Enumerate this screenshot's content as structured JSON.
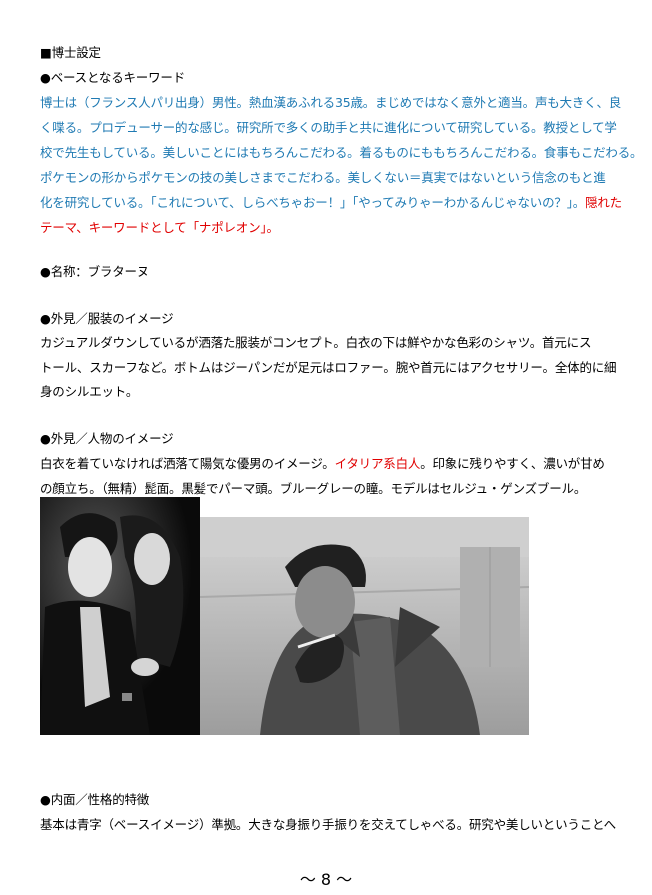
{
  "section_title": "■博士設定",
  "keywords": {
    "heading": "●ベースとなるキーワード",
    "lines": [
      "博士は（フランス人パリ出身）男性。熱血漢あふれる35歳。まじめではなく意外と適当。声も大きく、良",
      "く喋る。プロデューサー的な感じ。研究所で多くの助手と共に進化について研究している。教授として学",
      "校で先生もしている。美しいことにはもちろんこだわる。着るものにももちろんこだわる。食事もこだわる。",
      "ポケモンの形からポケモンの技の美しさまでこだわる。美しくない＝真実ではないという信念のもと進"
    ],
    "line5_blue": "化を研究している。「これについて、しらべちゃおー！」「やってみりゃーわかるんじゃないの？」。",
    "line5_red": "隠れた",
    "line6_red": "テーマ、キーワードとして「ナポレオン」。"
  },
  "name": {
    "text": "●名称：ブラターヌ"
  },
  "appearance_clothes": {
    "heading": "●外見／服装のイメージ",
    "lines": [
      "カジュアルダウンしているが洒落た服装がコンセプト。白衣の下は鮮やかな色彩のシャツ。首元にス",
      "トール、スカーフなど。ボトムはジーパンだが足元はロファー。腕や首元にはアクセサリー。全体的に細",
      "身のシルエット。"
    ]
  },
  "appearance_person": {
    "heading": "●外見／人物のイメージ",
    "line1_a": "白衣を着ていなければ洒落て陽気な優男のイメージ。",
    "line1_red": "イタリア系白人",
    "line1_b": "。印象に残りやすく、濃いが甘め",
    "line2": "の顔立ち。（無精）髭面。黒髪でパーマ頭。ブルーグレーの瞳。モデルはセルジュ・ゲンズブール。"
  },
  "inner": {
    "heading": "●内面／性格的特徴",
    "line1": "基本は青字（ベースイメージ）準拠。大きな身振り手振りを交えてしゃべる。研究や美しいということへ"
  },
  "page_number": "～ 8 ～",
  "colors": {
    "blue_text": "#1f7ab3",
    "red_text": "#e00000"
  }
}
